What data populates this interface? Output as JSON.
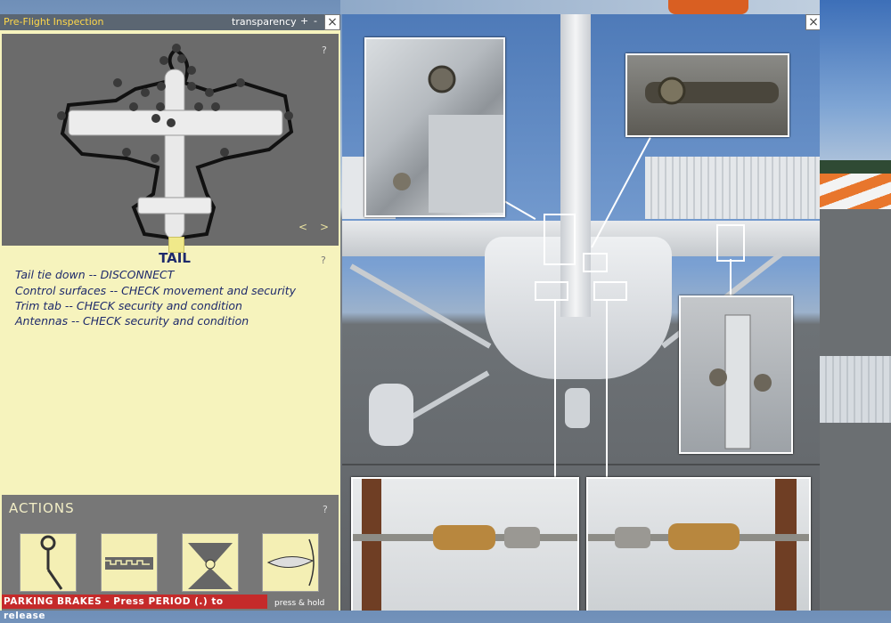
{
  "window": {
    "title": "Pre-Flight Inspection",
    "transparency_label": "transparency",
    "plus_label": "+",
    "minus_label": "-",
    "close_label": "×"
  },
  "map": {
    "help_label": "?",
    "prev_label": "<",
    "next_label": ">"
  },
  "checklist": {
    "title": "TAIL",
    "help_label": "?",
    "items": [
      "Tail tie down -- DISCONNECT",
      "Control surfaces -- CHECK movement and security",
      "Trim tab -- CHECK security and condition",
      "Antennas -- CHECK security and condition"
    ]
  },
  "actions": {
    "title": "ACTIONS",
    "help_label": "?",
    "buttons": [
      {
        "icon": "tie-down-icon"
      },
      {
        "icon": "control-surface-icon"
      },
      {
        "icon": "trim-tab-icon"
      },
      {
        "icon": "antenna-icon"
      }
    ],
    "caption": "press & hold"
  },
  "status": {
    "parking": "PARKING BRAKES - Press PERIOD (.) to release"
  },
  "viewer": {
    "close_label": "×"
  },
  "colors": {
    "panel_bg": "#f6f3bd",
    "titlebar": "#5b6672",
    "title_text": "#ffd84a",
    "checklist_text": "#1e2a6b",
    "warning": "#c52a2a"
  }
}
